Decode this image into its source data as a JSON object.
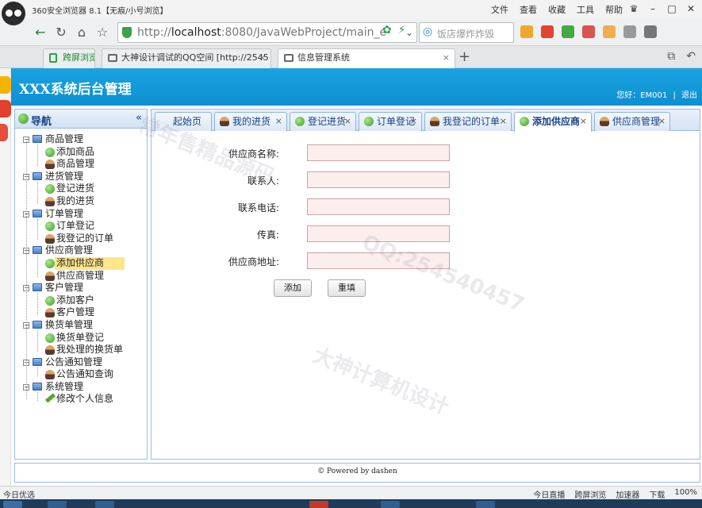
{
  "browser": {
    "window_title": "360安全浏览器 8.1【无痕/小号浏览】",
    "menu": [
      "文件",
      "查看",
      "收藏",
      "工具",
      "帮助"
    ],
    "url_gray": "http://",
    "url_host": "localhost",
    "url_rest": ":8080/JavaWebProject/main_e",
    "search_placeholder": "饭店爆炸炸毁",
    "tabs": [
      {
        "label": "跨屏浏览"
      },
      {
        "label": "大神设计调试的QQ空间 [http://2545"
      },
      {
        "label": "信息管理系统"
      }
    ],
    "status_left": "今日优选",
    "status_right": [
      "今日直播",
      "跨屏浏览",
      "加速器",
      "下载",
      "100%"
    ]
  },
  "app": {
    "title": "XXX系统后台管理",
    "user_prefix": "您好：",
    "user_name": "EM001",
    "separator": "|",
    "logout": "退出"
  },
  "nav": {
    "title": "导航",
    "collapse": "«",
    "groups": [
      {
        "label": "商品管理",
        "children": [
          {
            "label": "添加商品",
            "icon": "plus"
          },
          {
            "label": "商品管理",
            "icon": "user"
          }
        ]
      },
      {
        "label": "进货管理",
        "children": [
          {
            "label": "登记进货",
            "icon": "plus"
          },
          {
            "label": "我的进货",
            "icon": "user"
          }
        ]
      },
      {
        "label": "订单管理",
        "children": [
          {
            "label": "订单登记",
            "icon": "plus"
          },
          {
            "label": "我登记的订单",
            "icon": "user"
          }
        ]
      },
      {
        "label": "供应商管理",
        "children": [
          {
            "label": "添加供应商",
            "icon": "plus",
            "selected": true
          },
          {
            "label": "供应商管理",
            "icon": "user"
          }
        ]
      },
      {
        "label": "客户管理",
        "children": [
          {
            "label": "添加客户",
            "icon": "plus"
          },
          {
            "label": "客户管理",
            "icon": "user"
          }
        ]
      },
      {
        "label": "换货单管理",
        "children": [
          {
            "label": "换货单登记",
            "icon": "plus"
          },
          {
            "label": "我处理的换货单",
            "icon": "user"
          }
        ]
      },
      {
        "label": "公告通知管理",
        "children": [
          {
            "label": "公告通知查询",
            "icon": "user"
          }
        ]
      },
      {
        "label": "系统管理",
        "children": [
          {
            "label": "修改个人信息",
            "icon": "pencil"
          }
        ]
      }
    ]
  },
  "content_tabs": [
    {
      "label": "起始页",
      "icon": "none",
      "closable": false
    },
    {
      "label": "我的进货",
      "icon": "user",
      "closable": true
    },
    {
      "label": "登记进货",
      "icon": "plus",
      "closable": true
    },
    {
      "label": "订单登记",
      "icon": "plus",
      "closable": true
    },
    {
      "label": "我登记的订单",
      "icon": "user",
      "closable": true
    },
    {
      "label": "添加供应商",
      "icon": "plus",
      "closable": true,
      "active": true
    },
    {
      "label": "供应商管理",
      "icon": "user",
      "closable": true
    }
  ],
  "form": {
    "fields": [
      {
        "label": "供应商名称:",
        "value": ""
      },
      {
        "label": "联系人:",
        "value": ""
      },
      {
        "label": "联系电话:",
        "value": ""
      },
      {
        "label": "传真:",
        "value": ""
      },
      {
        "label": "供应商地址:",
        "value": ""
      }
    ],
    "submit_label": "添加",
    "reset_label": "重填"
  },
  "footer": {
    "text": "© Powered by dashen"
  },
  "watermarks": [
    "常年售精品源码",
    "QQ:254540457",
    "大神计算机设计"
  ]
}
